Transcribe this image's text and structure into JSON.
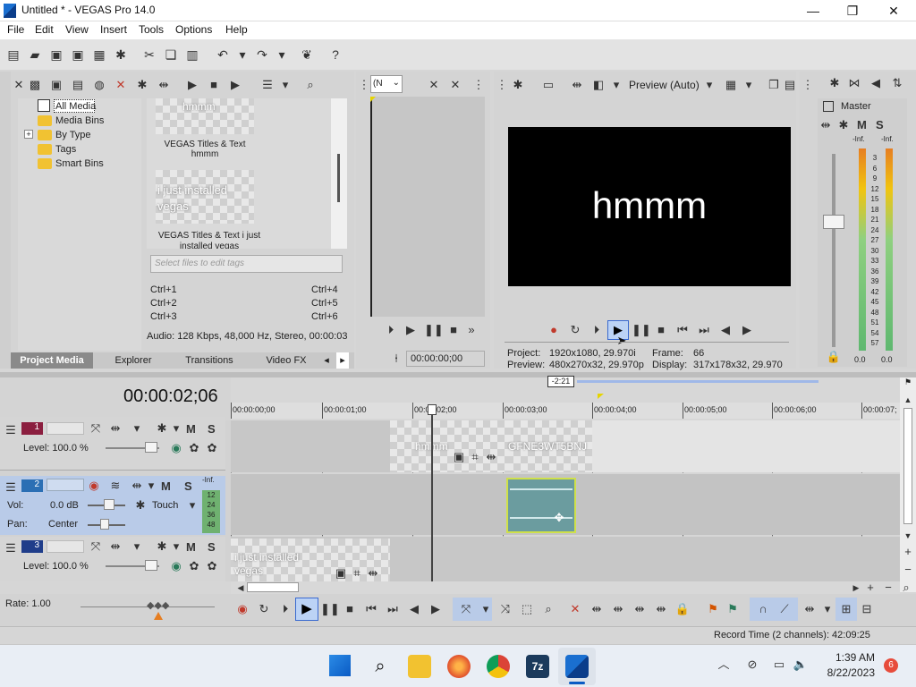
{
  "window": {
    "title": "Untitled * - VEGAS Pro 14.0",
    "minimize": "—",
    "restore": "❐",
    "close": "✕"
  },
  "menu": [
    "File",
    "Edit",
    "View",
    "Insert",
    "Tools",
    "Options",
    "Help"
  ],
  "toolbar_icons": [
    "new-icon",
    "open-icon",
    "save-icon",
    "save-as-icon",
    "properties-icon",
    "cut-icon",
    "copy-icon",
    "paste-icon",
    "undo-icon",
    "redo-icon",
    "render-icon",
    "help-icon"
  ],
  "project_media": {
    "tree": [
      {
        "label": "All Media",
        "selected": true
      },
      {
        "label": "Media Bins"
      },
      {
        "label": "By Type",
        "expandable": true,
        "expander": "+"
      },
      {
        "label": "Tags"
      },
      {
        "label": "Smart Bins"
      }
    ],
    "thumbs": [
      {
        "overlay": "hmmm",
        "caption": "VEGAS Titles & Text hmmm"
      },
      {
        "overlay": "i just installed vegas",
        "caption": "VEGAS Titles & Text i just installed vegas"
      }
    ],
    "tag_placeholder": "Select files to edit tags",
    "shortcuts": [
      "Ctrl+1",
      "Ctrl+4",
      "Ctrl+2",
      "Ctrl+5",
      "Ctrl+3",
      "Ctrl+6"
    ],
    "audio_info": "Audio: 128 Kbps, 48,000 Hz, Stereo, 00:00:03",
    "tabs": [
      "Project Media",
      "Explorer",
      "Transitions",
      "Video FX"
    ],
    "active_tab": "Project Media",
    "tab_scroll_prev": "◂",
    "tab_scroll_next": "▸"
  },
  "trimmer": {
    "dropdown": "(N",
    "timecode": "00:00:00;00"
  },
  "preview": {
    "mode": "Preview (Auto)",
    "text": "hmmm",
    "project_label": "Project:",
    "project_value": "1920x1080, 29.970i",
    "frame_label": "Frame:",
    "frame_value": "66",
    "preview_label": "Preview:",
    "preview_value": "480x270x32, 29.970p",
    "display_label": "Display:",
    "display_value": "317x178x32, 29.970"
  },
  "mixer": {
    "master": "Master",
    "m": "M",
    "s": "S",
    "inf_left": "-Inf.",
    "inf_right": "-Inf.",
    "scale": [
      "3",
      "6",
      "9",
      "12",
      "15",
      "18",
      "21",
      "24",
      "27",
      "30",
      "33",
      "36",
      "39",
      "42",
      "45",
      "48",
      "51",
      "54",
      "57"
    ],
    "left_value": "0.0",
    "right_value": "0.0"
  },
  "timeline": {
    "current_time": "00:00:02;06",
    "loop_marker": "-2:21",
    "ruler": [
      "00:00:00;00",
      "00:00:01;00",
      "00:00:02;00",
      "00:00:03;00",
      "00:00:04;00",
      "00:00:05;00",
      "00:00:06;00",
      "00:00:07;"
    ],
    "tracks": [
      {
        "num": "1",
        "level_label": "Level: 100.0 %",
        "m": "M",
        "s": "S"
      },
      {
        "num": "2",
        "vol_label": "Vol:",
        "vol_value": "0.0 dB",
        "pan_label": "Pan:",
        "pan_value": "Center",
        "automation": "Touch",
        "inf": "-Inf.",
        "meter": [
          "12",
          "24",
          "36",
          "48"
        ],
        "m": "M",
        "s": "S"
      },
      {
        "num": "3",
        "level_label": "Level: 100.0 %",
        "m": "M",
        "s": "S"
      }
    ],
    "clips": {
      "track1_a": "hmmm",
      "track1_b": "GFNE3WT5BNJ",
      "track3_a": "i just installed vegas"
    },
    "rate": "Rate: 1.00",
    "record_time": "Record Time (2 channels): 42:09:25"
  },
  "taskbar": {
    "time": "1:39 AM",
    "date": "8/22/2023",
    "badge": "6",
    "apps": [
      "start-icon",
      "search-icon",
      "file-explorer-icon",
      "firefox-icon",
      "chrome-icon",
      "7zip-icon",
      "vegas-icon"
    ],
    "app_7zip_label": "7z"
  }
}
